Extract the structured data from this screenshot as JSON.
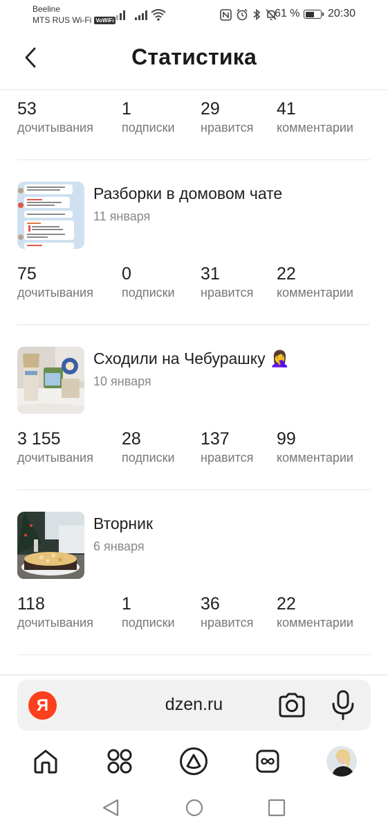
{
  "status_bar": {
    "operator_1": "Beeline",
    "operator_2": "MTS RUS Wi-Fi",
    "volte_badge": "VoWiFi",
    "battery_percent": "61 %",
    "battery_level": 0.61,
    "time": "20:30"
  },
  "header": {
    "back_icon": "chevron-left-icon",
    "title": "Статистика"
  },
  "entries": [
    {
      "article": null,
      "stats": {
        "reads": "53",
        "subs": "1",
        "likes": "29",
        "comments": "41"
      }
    },
    {
      "article": {
        "title": "Разборки в домовом чате",
        "date": "11 января",
        "thumb": "chat-screenshot"
      },
      "stats": {
        "reads": "75",
        "subs": "0",
        "likes": "31",
        "comments": "22"
      }
    },
    {
      "article": {
        "title": "Сходили на Чебурашку 🤦‍♀️",
        "date": "10 января",
        "thumb": "popcorn-photo"
      },
      "stats": {
        "reads": "3 155",
        "subs": "28",
        "likes": "137",
        "comments": "99"
      }
    },
    {
      "article": {
        "title": "Вторник",
        "date": "6 января",
        "thumb": "cake-photo"
      },
      "stats": {
        "reads": "118",
        "subs": "1",
        "likes": "36",
        "comments": "22"
      }
    }
  ],
  "labels": {
    "reads": "дочитывания",
    "subs": "подписки",
    "likes": "нравится",
    "comments": "комментарии"
  },
  "browser": {
    "logo_letter": "Я",
    "url": "dzen.ru",
    "accent": "#fc3f1d"
  },
  "bottom_nav": [
    "home-icon",
    "services-grid-icon",
    "alice-icon",
    "tabs-icon",
    "profile-avatar"
  ]
}
